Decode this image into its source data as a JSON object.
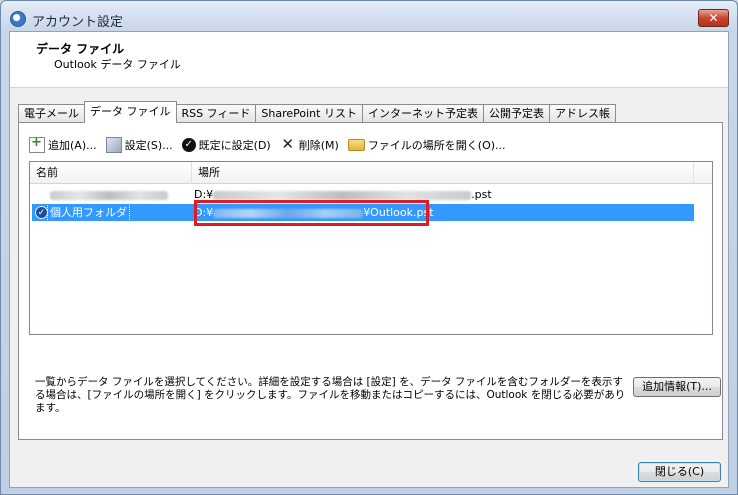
{
  "window": {
    "title": "アカウント設定",
    "close_glyph": "✕"
  },
  "header": {
    "title": "データ ファイル",
    "subtitle": "Outlook データ ファイル"
  },
  "tabs": [
    {
      "label": "電子メール"
    },
    {
      "label": "データ ファイル",
      "active": true
    },
    {
      "label": "RSS フィード"
    },
    {
      "label": "SharePoint リスト"
    },
    {
      "label": "インターネット予定表"
    },
    {
      "label": "公開予定表"
    },
    {
      "label": "アドレス帳"
    }
  ],
  "toolbar": {
    "add_label": "追加(A)...",
    "settings_label": "設定(S)...",
    "default_label": "既定に設定(D)",
    "delete_label": "削除(M)",
    "open_location_label": "ファイルの場所を開く(O)..."
  },
  "list": {
    "columns": [
      "名前",
      "場所"
    ],
    "rows": [
      {
        "name": "",
        "location_prefix": "D:¥",
        "location_suffix": ".pst",
        "selected": false
      },
      {
        "name": "個人用フォルダ",
        "location_prefix": "D:¥",
        "location_suffix": "¥Outlook.pst",
        "selected": true
      }
    ]
  },
  "hint": "一覧からデータ ファイルを選択してください。詳細を設定する場合は [設定] を、データ ファイルを含むフォルダーを表示する場合は、[ファイルの場所を開く] をクリックします。ファイルを移動またはコピーするには、Outlook を閉じる必要があります。",
  "buttons": {
    "more_info": "追加情報(T)...",
    "close": "閉じる(C)"
  },
  "colors": {
    "selection": "#3399ff",
    "highlight_box": "#e01b24"
  }
}
